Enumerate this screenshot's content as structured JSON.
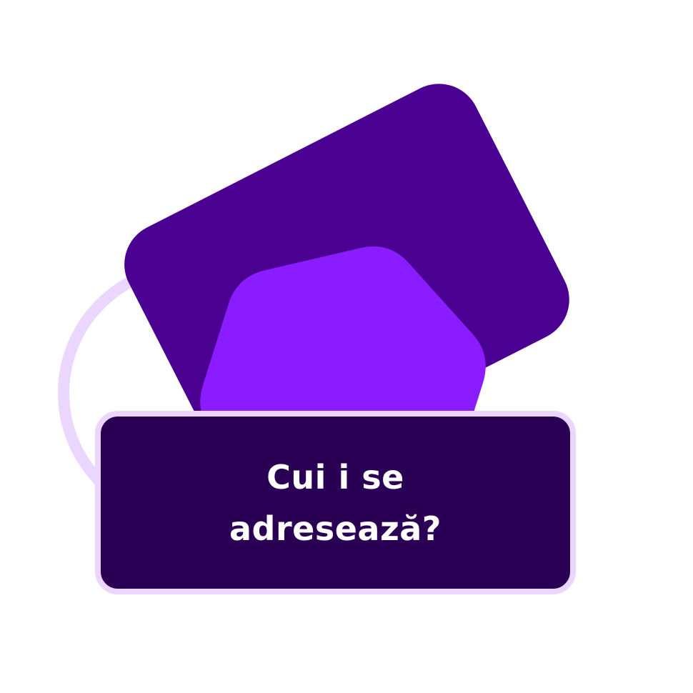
{
  "heading": {
    "line1": "Cui i se",
    "line2": "adresează?"
  },
  "colors": {
    "background": "#ffffff",
    "dark_purple_square": "#4a0090",
    "bright_purple_hexagon": "#8a1cff",
    "light_lavender_ring": "#ead6ff",
    "label_fill": "#2a0055",
    "label_text": "#ffffff"
  },
  "icons": [
    "tilted-square-shape",
    "hexagon-shape",
    "ring-outline-shape"
  ]
}
